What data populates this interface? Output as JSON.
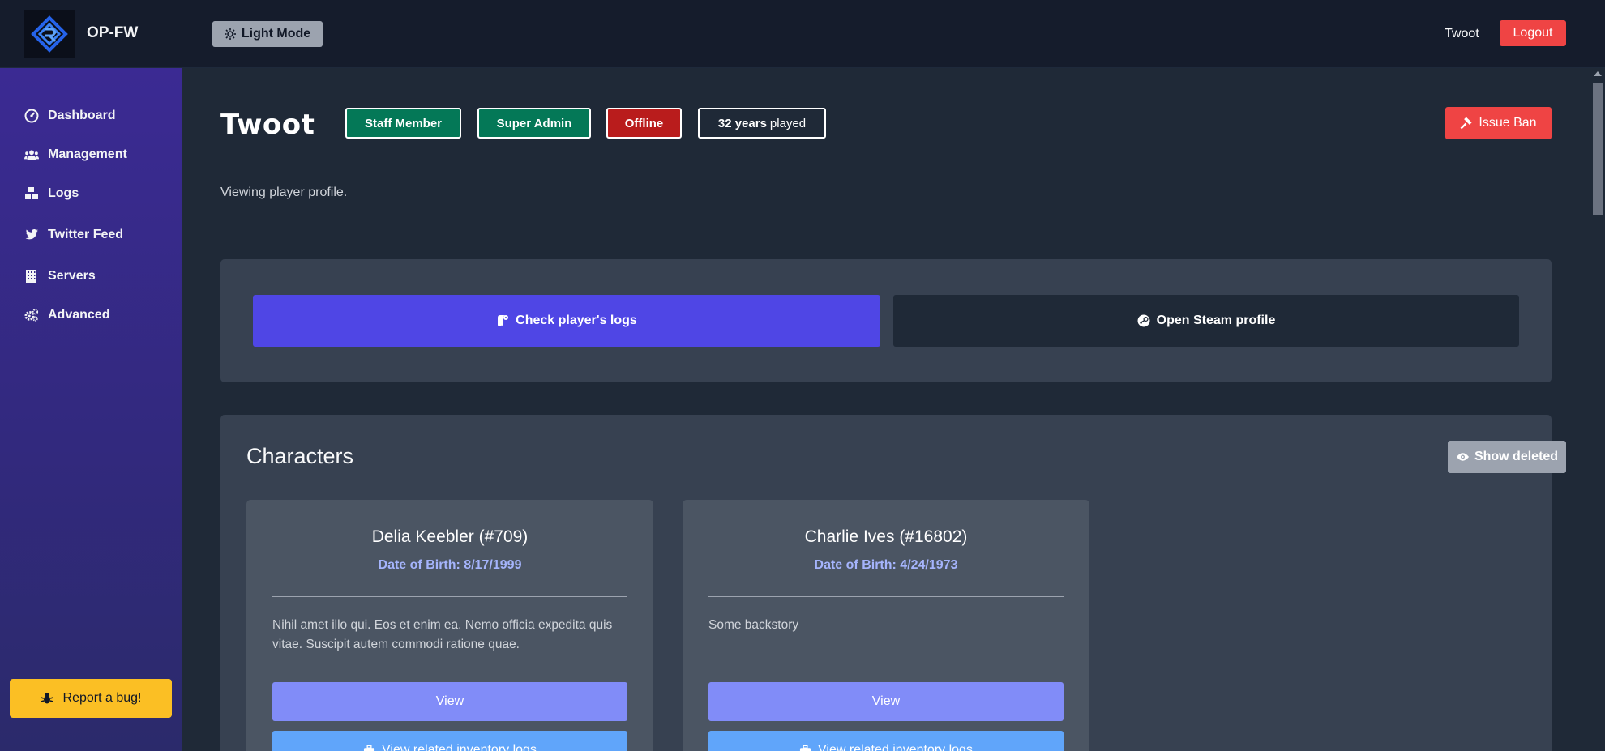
{
  "header": {
    "brand": "OP-FW",
    "light_mode_label": "Light Mode",
    "user": "Twoot",
    "logout_label": "Logout"
  },
  "sidebar": {
    "items": [
      {
        "label": "Dashboard",
        "icon": "dashboard-icon"
      },
      {
        "label": "Management",
        "icon": "users-icon"
      },
      {
        "label": "Logs",
        "icon": "boxes-icon"
      },
      {
        "label": "Twitter Feed",
        "icon": "twitter-icon"
      },
      {
        "label": "Servers",
        "icon": "building-icon"
      },
      {
        "label": "Advanced",
        "icon": "gears-icon"
      }
    ],
    "report_bug_label": "Report a bug!"
  },
  "profile": {
    "name": "Twoot",
    "badges": {
      "staff": "Staff Member",
      "super_admin": "Super Admin",
      "status": "Offline",
      "played_value": "32 years",
      "played_suffix": "played"
    },
    "issue_ban_label": "Issue Ban",
    "subtitle": "Viewing player profile."
  },
  "actions": {
    "check_logs_label": "Check player's logs",
    "steam_profile_label": "Open Steam profile"
  },
  "characters": {
    "title": "Characters",
    "show_deleted_label": "Show deleted",
    "list": [
      {
        "name": "Delia Keebler (#709)",
        "dob": "Date of Birth: 8/17/1999",
        "backstory": "Nihil amet illo qui. Eos et enim ea. Nemo officia expedita quis vitae. Suscipit autem commodi ratione quae.",
        "view_label": "View",
        "inventory_label": "View related inventory logs"
      },
      {
        "name": "Charlie Ives (#16802)",
        "dob": "Date of Birth: 4/24/1973",
        "backstory": "Some backstory",
        "view_label": "View",
        "inventory_label": "View related inventory logs"
      }
    ]
  },
  "colors": {
    "accent": "#4f46e5",
    "danger": "#ef4444",
    "success": "#047857",
    "warning": "#fbbf24"
  }
}
